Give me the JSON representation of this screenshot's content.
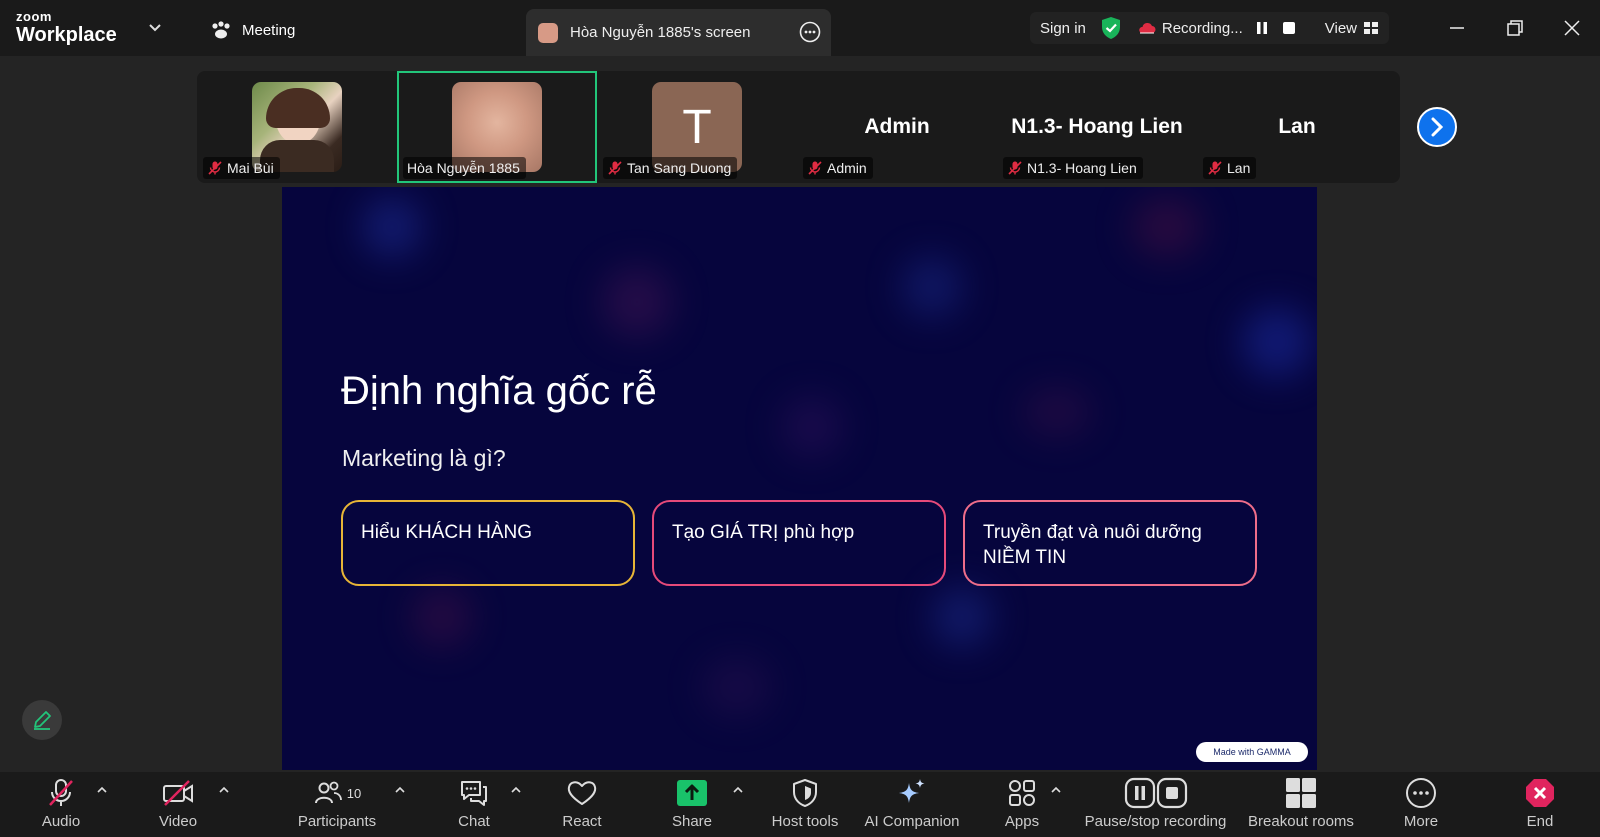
{
  "titlebar": {
    "brand_top": "zoom",
    "brand_bottom": "Workplace",
    "meeting_label": "Meeting",
    "share_tab_label": "Hòa Nguyễn 1885's screen",
    "sign_in": "Sign in",
    "recording": "Recording...",
    "view": "View"
  },
  "participants": [
    {
      "name": "Mai Bùi",
      "display": "photo"
    },
    {
      "name": "Hòa Nguyễn 1885",
      "display": "blur",
      "active": true
    },
    {
      "name": "Tan Sang Duong",
      "display": "initial",
      "initial": "T"
    },
    {
      "name": "Admin",
      "display": "text",
      "big": "Admin"
    },
    {
      "name": "N1.3- Hoang Lien",
      "display": "text",
      "big": "N1.3- Hoang Lien"
    },
    {
      "name": "Lan",
      "display": "text",
      "big": "Lan"
    }
  ],
  "slide": {
    "title": "Định nghĩa gốc rễ",
    "subtitle": "Marketing là gì?",
    "cards": [
      {
        "text": "Hiểu KHÁCH HÀNG",
        "color": "#e7b537"
      },
      {
        "text": "Tạo GIÁ TRỊ phù hợp",
        "color": "#e64a7a"
      },
      {
        "text": "Truyền đạt và nuôi dưỡng NIỀM TIN",
        "color": "#ee6d8a"
      }
    ],
    "badge": "Made with GAMMA"
  },
  "toolbar": {
    "audio": "Audio",
    "video": "Video",
    "participants": "Participants",
    "participants_count": "10",
    "chat": "Chat",
    "react": "React",
    "share": "Share",
    "host_tools": "Host tools",
    "ai_companion": "AI Companion",
    "apps": "Apps",
    "pause_stop_recording": "Pause/stop recording",
    "breakout_rooms": "Breakout rooms",
    "more": "More",
    "end": "End"
  },
  "colors": {
    "active_speaker": "#22c57a",
    "share_green": "#19c26a",
    "end_red": "#e0245e",
    "next_blue": "#0e72ed",
    "muted_red": "#e02c43"
  }
}
